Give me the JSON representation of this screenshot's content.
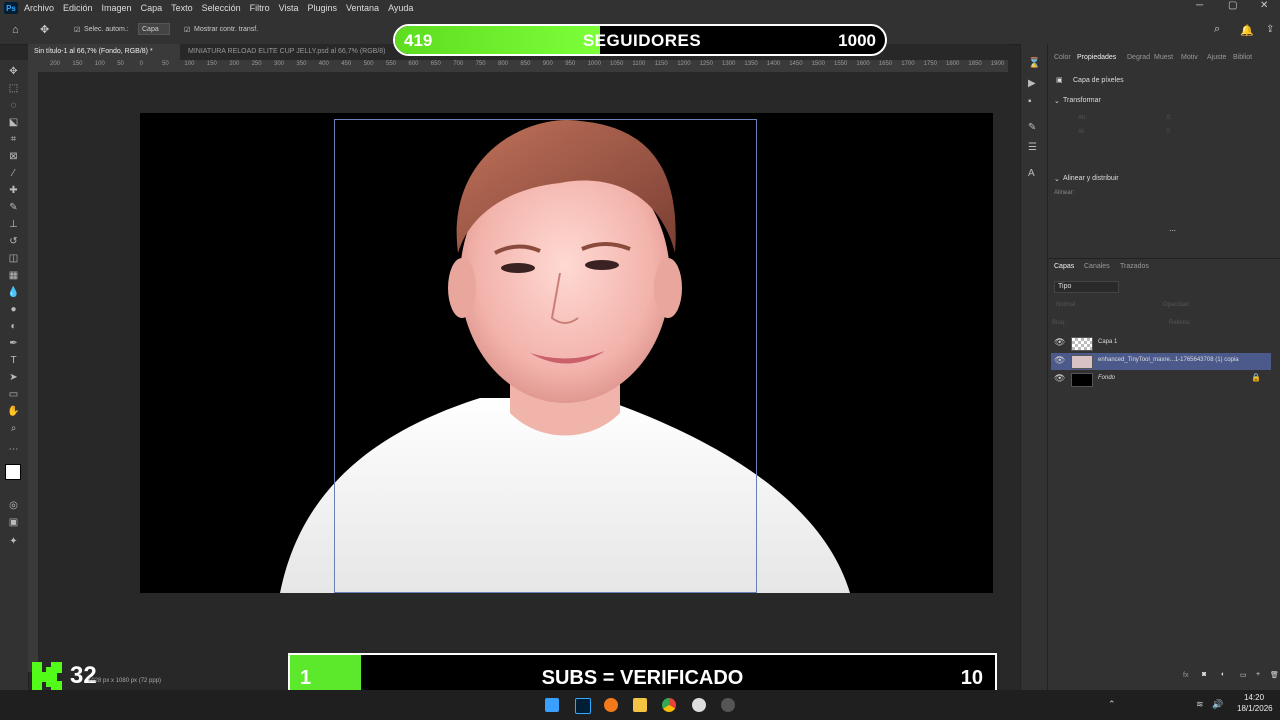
{
  "menu": [
    "Archivo",
    "Edición",
    "Imagen",
    "Capa",
    "Texto",
    "Selección",
    "Filtro",
    "Vista",
    "Plugins",
    "Ventana",
    "Ayuda"
  ],
  "options": {
    "auto_select": "Selec. autom.:",
    "auto_select_value": "Capa",
    "show_transform": "Mostrar contr. transf."
  },
  "tabs": [
    {
      "label": "Sin título-1 al 66,7% (Fondo, RGB/8) *"
    },
    {
      "label": "MINIATURA RELOAD ELITE CUP JELLY.psd al 66,7% (RGB/8)"
    }
  ],
  "ruler_ticks": [
    "200",
    "150",
    "100",
    "50",
    "0",
    "50",
    "100",
    "150",
    "200",
    "250",
    "300",
    "350",
    "400",
    "450",
    "500",
    "550",
    "600",
    "650",
    "700",
    "750",
    "800",
    "850",
    "900",
    "950",
    "1000",
    "1050",
    "1100",
    "1150",
    "1200",
    "1250",
    "1300",
    "1350",
    "1400",
    "1450",
    "1500",
    "1550",
    "1600",
    "1650",
    "1700",
    "1750",
    "1800",
    "1850",
    "1900"
  ],
  "status": {
    "doc_size": "1028 px x 1080 px (72 ppp)"
  },
  "panel": {
    "tabs": [
      "Color",
      "Propiedades",
      "Degrad",
      "Muest",
      "Motiv",
      "Ajuste",
      "Bibliot"
    ],
    "pixel_layer": "Capa de píxeles",
    "transform": "Transformar",
    "transform_fields": {
      "an": "An:",
      "al": "Al:",
      "x": "X:",
      "y": "Y:"
    },
    "align": "Alinear y distribuir",
    "align_label": "Alinear:",
    "layers_tabs": [
      "Capas",
      "Canales",
      "Trazados"
    ],
    "filter": "Tipo",
    "blend": "Normal",
    "opacity": "Opacidad:",
    "lock": "Bloq.:",
    "fill": "Relleno:",
    "layers": [
      {
        "name": "Capa 1",
        "selected": false
      },
      {
        "name": "enhanced_TinyTool_maxre...1-1765643708 (1) copia",
        "selected": true
      },
      {
        "name": "Fondo",
        "selected": false
      }
    ]
  },
  "overlay_top": {
    "current": "419",
    "label": "SEGUIDORES",
    "goal": "1000",
    "progress": 0.419,
    "color": "#5edc1f"
  },
  "overlay_bottom": {
    "current": "1",
    "label": "SUBS = VERIFICADO",
    "goal": "10",
    "progress": 0.1,
    "color": "#5ce92b"
  },
  "kick": {
    "count": "32",
    "color": "#53fc18"
  },
  "taskbar": {
    "time": "14:20",
    "date": "18/1/2026"
  }
}
